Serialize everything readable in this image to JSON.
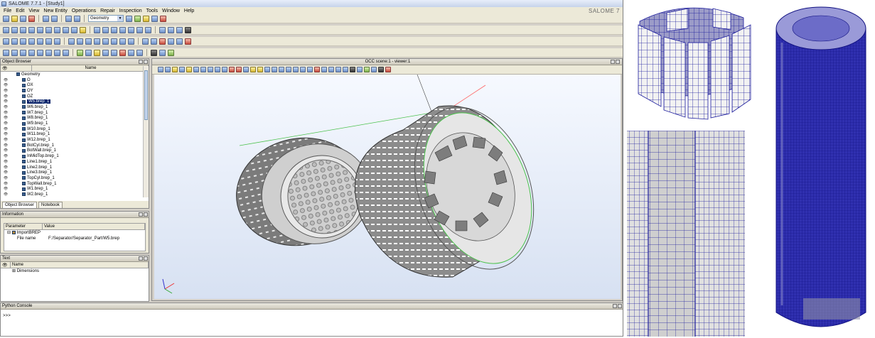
{
  "app": {
    "title": "SALOME 7.7.1 - [Study1]",
    "brand": "SALOME 7"
  },
  "menu": [
    "File",
    "Edit",
    "View",
    "New Entity",
    "Operations",
    "Repair",
    "Inspection",
    "Tools",
    "Window",
    "Help"
  ],
  "toolbar": {
    "module_combo": "Geometry"
  },
  "object_browser": {
    "title": "Object Browser",
    "column_name": "Name",
    "items": [
      {
        "label": "Geometry",
        "indent": 0
      },
      {
        "label": "O",
        "indent": 1
      },
      {
        "label": "OX",
        "indent": 1
      },
      {
        "label": "OY",
        "indent": 1
      },
      {
        "label": "OZ",
        "indent": 1
      },
      {
        "label": "W5.brep_1",
        "indent": 1,
        "selected": true
      },
      {
        "label": "W6.brep_1",
        "indent": 1
      },
      {
        "label": "W7.brep_1",
        "indent": 1
      },
      {
        "label": "W8.brep_1",
        "indent": 1
      },
      {
        "label": "W9.brep_1",
        "indent": 1
      },
      {
        "label": "W10.brep_1",
        "indent": 1
      },
      {
        "label": "W11.brep_1",
        "indent": 1
      },
      {
        "label": "W12.brep_1",
        "indent": 1
      },
      {
        "label": "BotCyl.brep_1",
        "indent": 1
      },
      {
        "label": "BotWall.brep_1",
        "indent": 1
      },
      {
        "label": "InMidTop.brep_1",
        "indent": 1
      },
      {
        "label": "Line1.brep_1",
        "indent": 1
      },
      {
        "label": "Line2.brep_1",
        "indent": 1
      },
      {
        "label": "Line3.brep_1",
        "indent": 1
      },
      {
        "label": "TopCyl.brep_1",
        "indent": 1
      },
      {
        "label": "TopWall.brep_1",
        "indent": 1
      },
      {
        "label": "W1.brep_1",
        "indent": 1
      },
      {
        "label": "W2.brep_1",
        "indent": 1
      }
    ],
    "tabs": [
      "Object Browser",
      "Notebook"
    ]
  },
  "information": {
    "title": "Information",
    "col_parameter": "Parameter",
    "col_value": "Value",
    "node": "ImportBREP",
    "param": "File name",
    "value": "F:/Separator/Separator_Part/W5.brep"
  },
  "text_panel": {
    "title": "Text",
    "col_name": "Name",
    "item": "Dimensions"
  },
  "viewer": {
    "title": "OCC scene:1 - viewer:1"
  },
  "python_console": {
    "title": "Python Console",
    "prompt": ">>>"
  },
  "colors": {
    "mesh_blue": "#1a1a9c",
    "shape_gray": "#8c8c8c",
    "selection": "#0a246a"
  }
}
